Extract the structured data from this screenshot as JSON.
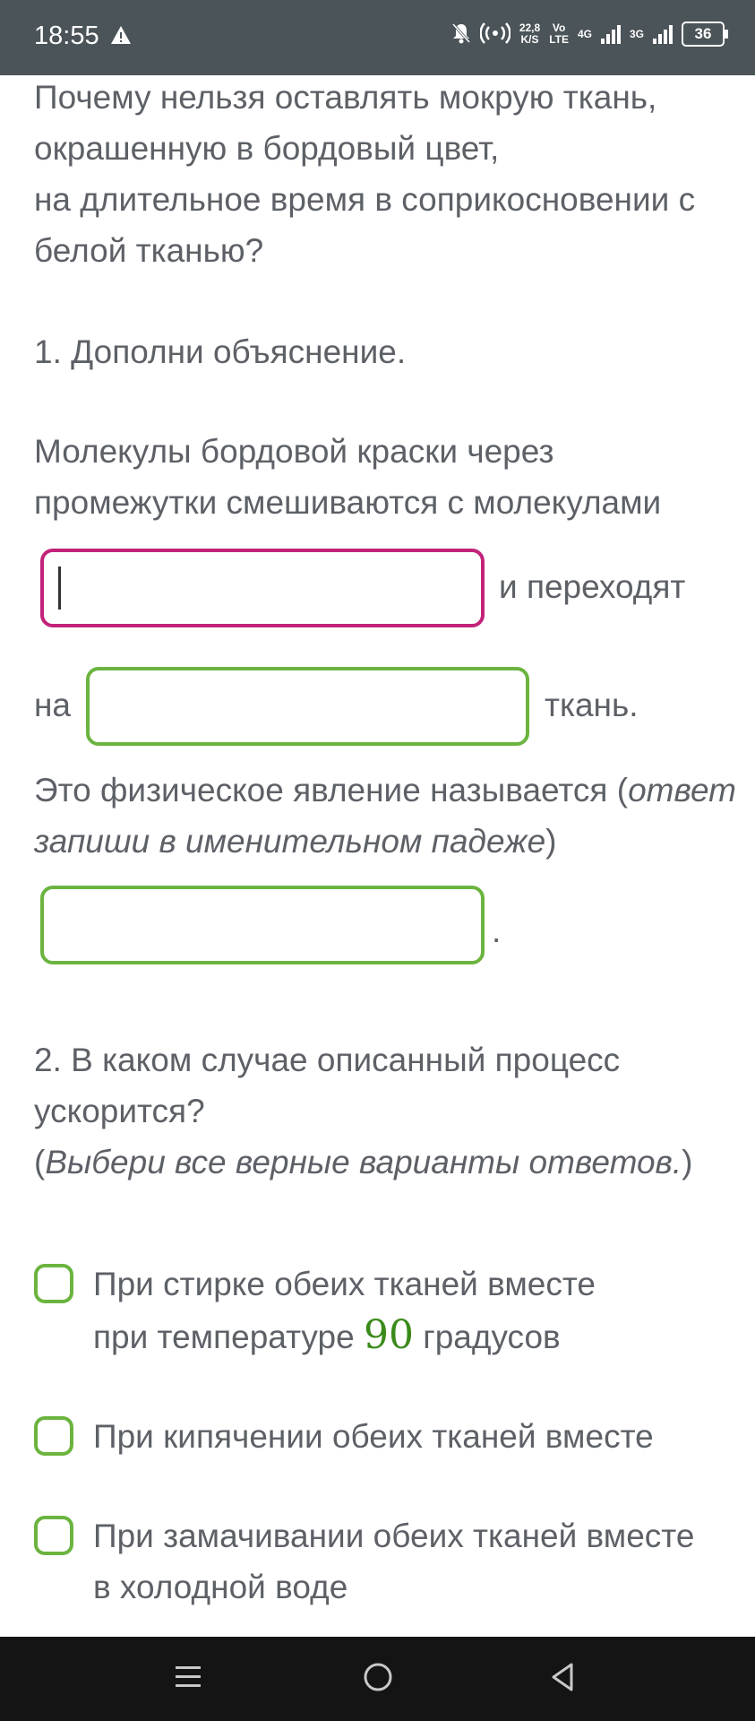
{
  "status_bar": {
    "time": "18:55",
    "speed": "22,8",
    "speed_unit": "K/S",
    "volte_top": "Vo",
    "volte_bottom": "LTE",
    "net1": "4G",
    "net2": "3G",
    "battery": "36"
  },
  "question": {
    "line1": "Почему нельзя оставлять мокрую ткань,",
    "line2": "окрашенную в бордовый цвет,",
    "line3": "на длительное время в соприкосновении с",
    "line4": "белой тканью?"
  },
  "task1": {
    "title": "1. Дополни объяснение.",
    "line1": "Молекулы бордовой краски через",
    "line2": "промежутки смешиваются с молекулами",
    "after_first_field": "и переходят",
    "before_second_field": "на",
    "after_second_field": "ткань.",
    "phenomenon_text": "Это физическое явление называется (",
    "phenomenon_hint_1": "ответ",
    "phenomenon_hint_2": "запиши в именительном падеже",
    "phenomenon_close": ")",
    "period": ".",
    "field1_value": "",
    "field2_value": "",
    "field3_value": ""
  },
  "task2": {
    "line1": "2. В каком случае описанный процесс",
    "line2": "ускорится?",
    "hint_open": "(",
    "hint": "Выбери все верные варианты ответов.",
    "hint_close": ")",
    "options": [
      {
        "line1": "При стирке обеих тканей вместе",
        "line2_prefix": "при температуре ",
        "number": "90",
        "line2_suffix": " градусов",
        "checked": false
      },
      {
        "line1": "При кипячении обеих тканей вместе",
        "checked": false
      },
      {
        "line1": "При замачивании обеих тканей вместе",
        "line2": "в холодной воде",
        "checked": false
      }
    ]
  },
  "colors": {
    "active_field": "#c2237a",
    "field_border": "#6bb43f",
    "text": "#5d6167",
    "status_bar": "#4b5458",
    "nav_bar": "#141414"
  }
}
